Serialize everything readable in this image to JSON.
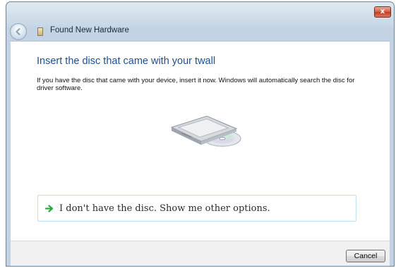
{
  "window": {
    "title": "Found New Hardware",
    "close_glyph": "x"
  },
  "content": {
    "heading": "Insert the disc that came with your twall",
    "description": "If you have the disc that came with your device, insert it now.  Windows will automatically search the disc for driver software.",
    "option_label": "I don't have the disc.  Show me other options."
  },
  "footer": {
    "cancel_label": "Cancel"
  },
  "icons": {
    "back": "back-arrow-icon",
    "hardware": "hardware-device-icon",
    "drive": "optical-drive-icon",
    "option": "green-arrow-icon",
    "close": "close-icon"
  },
  "colors": {
    "heading": "#1f4f8f",
    "close_button": "#c33b21",
    "option_border": "#bfe0f3",
    "option_arrow": "#2aa84a"
  }
}
